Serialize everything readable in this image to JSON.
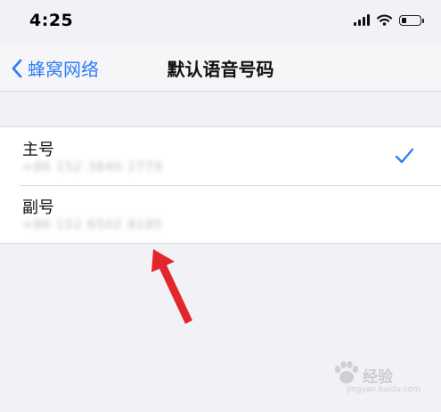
{
  "status_bar": {
    "time": "4:25",
    "battery_level": 0.3
  },
  "nav": {
    "back_label": "蜂窝网络",
    "title": "默认语音号码"
  },
  "lines": [
    {
      "label": "主号",
      "number": "+86 152 3840 2779",
      "selected": true
    },
    {
      "label": "副号",
      "number": "+86 152 6502 8185",
      "selected": false
    }
  ],
  "watermark": {
    "brand": "经验",
    "url": "jingyan.baidu.com"
  },
  "colors": {
    "accent": "#2f7ef4",
    "arrow": "#e2262c",
    "background": "#f2f2f6"
  },
  "icons": {
    "back": "chevron-left-icon",
    "selected": "checkmark-icon",
    "signal": "cellular-signal-icon",
    "wifi": "wifi-icon",
    "battery": "battery-icon"
  }
}
